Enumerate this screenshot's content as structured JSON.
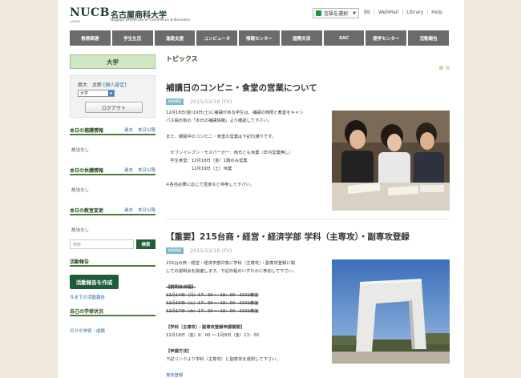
{
  "header": {
    "logo_mark": "NUCB",
    "logo_sub": "JAPAN",
    "logo_jp": "名古屋商科大学",
    "logo_en": "Nagoya University of Commerce & Business",
    "lang_label": "言語を選択",
    "links": [
      "Bb",
      "WebMail",
      "Library",
      "Help"
    ]
  },
  "nav": [
    "教務関連",
    "学生生活",
    "進路支援",
    "コンピュータ",
    "情報センター",
    "国際交流",
    "SAC",
    "語学センター",
    "活動報告"
  ],
  "sidebar": {
    "title": "大学",
    "user_name": "商大　太郎",
    "user_link": "[個人設定]",
    "select_value": "大学",
    "logout_label": "ログアウト",
    "sections": [
      {
        "title": "本日の補講情報",
        "link_past": "過去",
        "link_future": "本日以降",
        "body": "該当なし"
      },
      {
        "title": "本日の休講情報",
        "link_past": "過去",
        "link_future": "本日以降",
        "body": "該当なし"
      },
      {
        "title": "本日の教室変更",
        "link_past": "過去",
        "link_future": "本日以降",
        "body": "該当なし"
      }
    ],
    "search_placeholder": "検索",
    "search_button": "検索",
    "activity_head": "活動報告",
    "activity_button": "活動報告を作成",
    "activity_link": "今までの活動報告",
    "study_head": "自己の学修状況",
    "study_link": "日々の学修・成績"
  },
  "main": {
    "topics_label": "トピックス",
    "articles": [
      {
        "title": "補講日のコンビニ・食堂の営業について",
        "tag": "教務関連",
        "date": "2015/12/18 (Fri)",
        "lines": [
          "12月18日(金)19日(土)に補講がある学生は、補講の時限と教室をキャン",
          "パス掲示板の「本日の補講情報」より確認して下さい。",
          "",
          "また、期間中のコンビニ・食堂の営業は下記の通りです。",
          "",
          "　セブンイレブン・モスバーガー：両日とも休業（年内営業無し）",
          "　学生食堂：12月18日（金）1階のみ営業",
          "　　　　　　12月19日（土）休業",
          "",
          "※各自必要に応じて昼食など持参して下さい。"
        ]
      },
      {
        "title": "【重要】215台商・経営・経済学部 学科（主専攻）・副専攻登録",
        "tag": "教務関連",
        "date": "2015/12/18 (Fri)",
        "lines": [
          "215台の商・経営・経済学部対象に学科（主専攻）・副専攻登録に関",
          "しての説明会を開催します。下記日程のいずれかに参加して下さい。",
          "",
          "【説明会日程】",
          "12月14日（月）17：30 ～ 18：00　2101教室",
          "12月15日（火）17：30 ～ 18：00　2101教室",
          "12月17日（木）17：30 ～ 18：00　2101教室",
          "",
          "【学科（主専攻）・副専攻登録申請期間】",
          "12月18日（金）9：00 ～ 1月8日（金）13：00",
          "",
          "【申請方法】",
          "下記リンクより学科（主専攻）と副専攻を選択して下さい。",
          "",
          "専攻登録"
        ]
      }
    ]
  }
}
